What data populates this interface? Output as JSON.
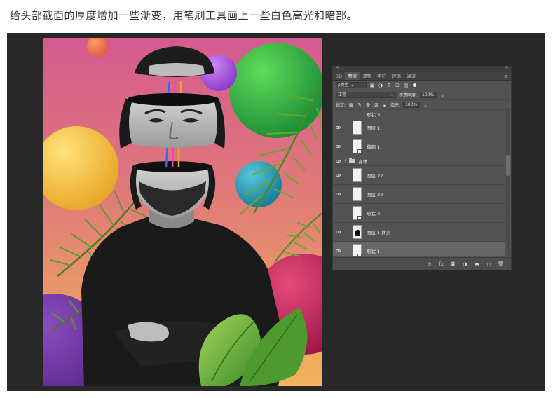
{
  "caption": "给头部截面的厚度增加一些渐变，用笔刷工具画上一些白色高光和暗部。",
  "colors": {
    "workspace_bg": "#282828",
    "panel_bg": "#535353",
    "selected_row": "#666666",
    "bg_gradient_top": "#d85a8c",
    "bg_gradient_bottom": "#f0b060",
    "ball_green": "#3cb84c",
    "ball_yellow": "#f2c23a",
    "ball_purple": "#b060e0",
    "ball_teal": "#2ea0b8",
    "ball_magenta": "#c2245e",
    "ball_orange": "#f07c50"
  },
  "layers_panel": {
    "close_icon": "×",
    "collapse_icon": "«",
    "tabs": [
      "3D",
      "图层",
      "调整",
      "字符",
      "段落",
      "通道"
    ],
    "active_tab": "图层",
    "menu_icon": "≡",
    "filter_label": "ρ类型",
    "blend_mode": "正常",
    "opacity_label": "不透明度:",
    "opacity_value": "100%",
    "lock_label": "锁定:",
    "fill_label": "填充:",
    "fill_value": "100%",
    "layers": [
      {
        "name": "形状 3",
        "visible": false,
        "kind": "shape"
      },
      {
        "name": "图层 1",
        "visible": true,
        "kind": "layer"
      },
      {
        "name": "椭圆 1",
        "visible": true,
        "kind": "shape"
      },
      {
        "name": "身体",
        "visible": true,
        "kind": "group"
      },
      {
        "name": "图层 22",
        "visible": true,
        "kind": "layer"
      },
      {
        "name": "图层 20",
        "visible": true,
        "kind": "layer"
      },
      {
        "name": "形状 2",
        "visible": false,
        "kind": "shape"
      },
      {
        "name": "图层 1 拷贝",
        "visible": true,
        "kind": "person"
      },
      {
        "name": "形状 1",
        "visible": true,
        "kind": "shape",
        "selected": true
      }
    ],
    "bottom_icons": [
      "link-icon",
      "fx-icon",
      "mask-icon",
      "adjustment-icon",
      "folder-icon",
      "new-layer-icon",
      "trash-icon"
    ],
    "bottom_glyphs": [
      "⊝",
      "fx",
      "◘",
      "◑",
      "▬",
      "◻",
      "🗑"
    ]
  }
}
